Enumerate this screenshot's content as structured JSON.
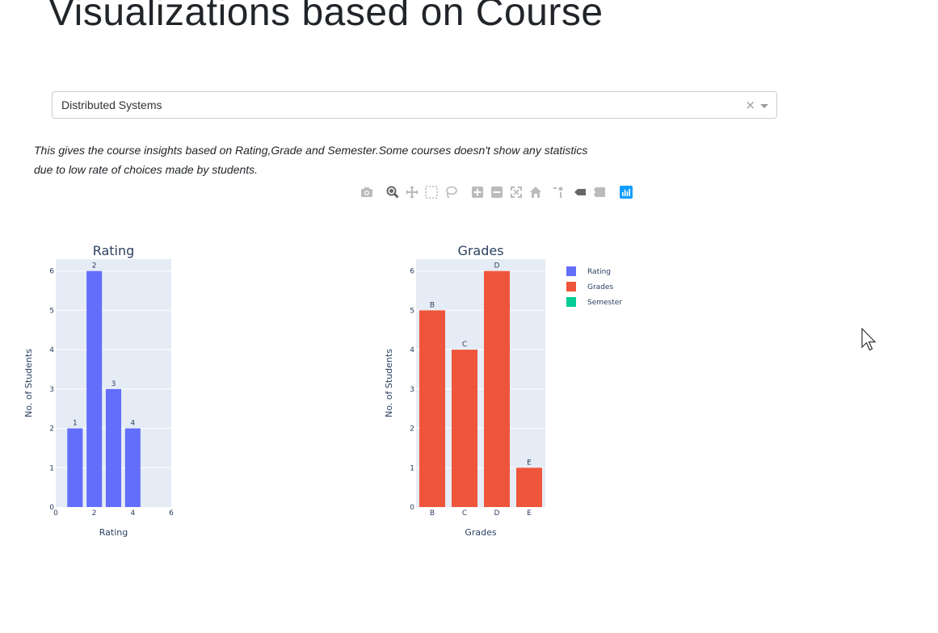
{
  "page": {
    "title": "Visualizations based on Course",
    "description": "This gives the course insights based on Rating,Grade and Semester.Some courses doesn't show any statistics due to low rate of choices made by students."
  },
  "course_dropdown": {
    "selected": "Distributed Systems",
    "clear_glyph": "×"
  },
  "modebar": {
    "buttons": [
      "camera-icon",
      "zoom-icon",
      "pan-icon",
      "box-select-icon",
      "lasso-select-icon",
      "zoom-in-icon",
      "zoom-out-icon",
      "autoscale-icon",
      "reset-axes-icon",
      "spike-lines-icon",
      "hover-closest-icon",
      "hover-compare-icon",
      "plotly-logo-icon"
    ]
  },
  "chart_data": [
    {
      "type": "bar",
      "title": "Rating",
      "xlabel": "Rating",
      "ylabel": "No. of Students",
      "x": [
        1,
        2,
        3,
        4
      ],
      "values": [
        2,
        6,
        3,
        2
      ],
      "bar_labels": [
        "1",
        "2",
        "3",
        "4"
      ],
      "xlim": [
        0,
        6
      ],
      "ylim": [
        0,
        6.3
      ],
      "xticks": [
        "0",
        "2",
        "4",
        "6"
      ],
      "yticks": [
        "0",
        "1",
        "2",
        "3",
        "4",
        "5",
        "6"
      ],
      "color": "#636efa",
      "grid": true
    },
    {
      "type": "bar",
      "title": "Grades",
      "xlabel": "Grades",
      "ylabel": "No. of Students",
      "categories": [
        "B",
        "C",
        "D",
        "E"
      ],
      "values": [
        5,
        4,
        6,
        1
      ],
      "bar_labels": [
        "B",
        "C",
        "D",
        "E"
      ],
      "ylim": [
        0,
        6.3
      ],
      "yticks": [
        "0",
        "1",
        "2",
        "3",
        "4",
        "5",
        "6"
      ],
      "color": "#ef553b",
      "grid": true
    }
  ],
  "legend": {
    "placement": "right",
    "items": [
      {
        "name": "Rating",
        "color": "#636efa"
      },
      {
        "name": "Grades",
        "color": "#ef553b"
      },
      {
        "name": "Semester",
        "color": "#00cc96"
      }
    ]
  },
  "colors": {
    "plot_bg": "#e5ecf6",
    "text": "#2a3f5f",
    "modebar_icon": "#bbbbbb",
    "modebar_active": "#666666",
    "plotly_logo": "#119dff"
  }
}
